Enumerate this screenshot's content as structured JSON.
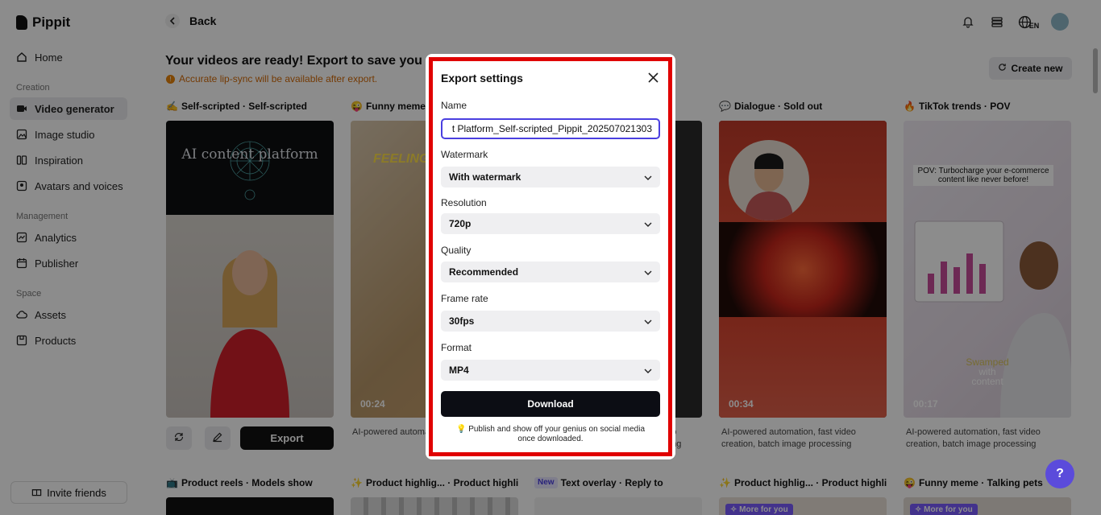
{
  "app": {
    "name": "Pippit"
  },
  "sidebar": {
    "home": "Home",
    "section_creation": "Creation",
    "video_generator": "Video generator",
    "image_studio": "Image studio",
    "inspiration": "Inspiration",
    "avatars_voices": "Avatars and voices",
    "section_management": "Management",
    "analytics": "Analytics",
    "publisher": "Publisher",
    "section_space": "Space",
    "assets": "Assets",
    "products": "Products",
    "invite": "Invite friends"
  },
  "header": {
    "back": "Back",
    "lang": "EN"
  },
  "main": {
    "heading": "Your videos are ready! Export to save you",
    "notice": "Accurate lip-sync will be available after export.",
    "create_new": "Create new",
    "thumb_text": "AI content platform",
    "export": "Export",
    "cards": [
      {
        "emoji": "✍",
        "title": "Self-scripted · Self-scripted",
        "duration": "",
        "desc": ""
      },
      {
        "emoji": "😜",
        "title": "Funny meme · T",
        "duration": "00:24",
        "desc": "AI-powered automat batch image process",
        "overlay": "FEELING CONTEN"
      },
      {
        "emoji": "",
        "title": "",
        "duration": "",
        "desc": "n, fast video creation,\nsing"
      },
      {
        "emoji": "💬",
        "title": "Dialogue · Sold out",
        "duration": "00:34",
        "desc": "AI-powered automation, fast video creation, batch image processing"
      },
      {
        "emoji": "🔥",
        "title": "TikTok trends · POV",
        "duration": "00:17",
        "desc": "AI-powered automation, fast video creation, batch image processing",
        "caption": "POV: Turbocharge your e-commerce content like never before!",
        "sub1": "Swamped",
        "sub2": "with",
        "sub3": "content"
      }
    ],
    "row2": [
      {
        "emoji": "📺",
        "title": "Product reels · Models show"
      },
      {
        "emoji": "✨",
        "title": "Product highlig... · Product highlig..."
      },
      {
        "badge": "New",
        "title": "Text overlay · Reply to"
      },
      {
        "emoji": "✨",
        "title": "Product highlig... · Product highlig...",
        "pill": "✧ More for you"
      },
      {
        "emoji": "😜",
        "title": "Funny meme · Talking pets",
        "pill": "✧ More for you"
      }
    ]
  },
  "modal": {
    "title": "Export settings",
    "name_label": "Name",
    "name_value": "t Platform_Self-scripted_Pippit_202507021303",
    "watermark_label": "Watermark",
    "watermark_value": "With watermark",
    "resolution_label": "Resolution",
    "resolution_value": "720p",
    "quality_label": "Quality",
    "quality_value": "Recommended",
    "framerate_label": "Frame rate",
    "framerate_value": "30fps",
    "format_label": "Format",
    "format_value": "MP4",
    "download": "Download",
    "tip": "Publish and show off your genius on social media once downloaded."
  },
  "help": "?"
}
